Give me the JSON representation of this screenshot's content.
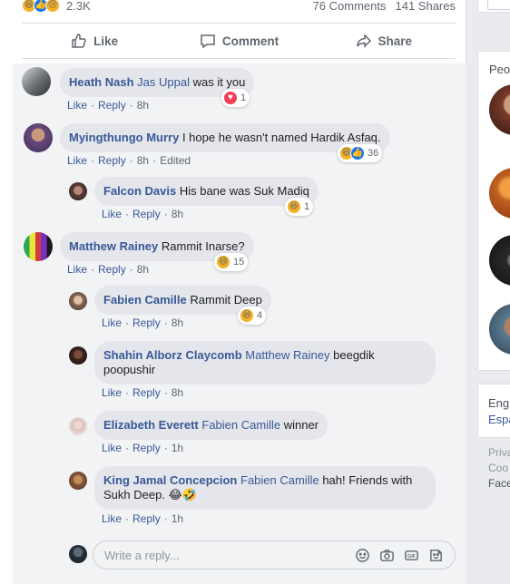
{
  "post_stats": {
    "reaction_count": "2.3K",
    "comments": "76 Comments",
    "shares": "141 Shares"
  },
  "actions": {
    "like": "Like",
    "comment": "Comment",
    "share": "Share"
  },
  "meta_labels": {
    "like": "Like",
    "reply": "Reply",
    "dot": "·"
  },
  "comments": [
    {
      "name": "Heath Nash",
      "tag": "Jas Uppal",
      "text": "was it you",
      "time": "8h",
      "reactions": "1"
    },
    {
      "name": "Myingthungo Murry",
      "tag": "",
      "text": "I hope he wasn't named Hardik Asfaq.",
      "time": "8h",
      "edited": "Edited",
      "reactions": "36"
    },
    {
      "name": "Falcon Davis",
      "tag": "",
      "text": "His bane was Suk Madiq",
      "time": "8h",
      "reactions": "1"
    },
    {
      "name": "Matthew Rainey",
      "tag": "",
      "text": "Rammit Inarse?",
      "time": "8h",
      "reactions": "15"
    },
    {
      "name": "Fabien Camille",
      "tag": "",
      "text": "Rammit Deep",
      "time": "8h",
      "reactions": "4"
    },
    {
      "name": "Shahin Alborz Claycomb",
      "tag": "Matthew Rainey",
      "text": "beegdik poopushir",
      "time": "8h"
    },
    {
      "name": "Elizabeth Everett",
      "tag": "Fabien Camille",
      "text": "winner",
      "time": "1h"
    },
    {
      "name": "King Jamal Concepcion",
      "tag": "Fabien Camille",
      "text": "hah! Friends with Sukh Deep.",
      "emoji": "😂🤣",
      "time": "1h"
    }
  ],
  "reply_box": {
    "placeholder": "Write a reply..."
  },
  "sidebar": {
    "people_heading": "Peo",
    "lang_current": "Eng",
    "lang_alt": "Espa",
    "footer_1": "Priva",
    "footer_2": "Coo",
    "footer_3": "Face"
  },
  "colors": {
    "link": "#385898",
    "bubble": "#e4e6eb",
    "background": "#e9ebee"
  }
}
